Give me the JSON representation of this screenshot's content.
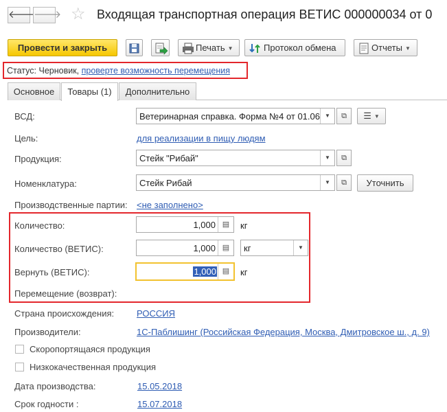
{
  "window": {
    "back_glyph": "🡐",
    "forward_glyph": "🡒",
    "title": "Входящая транспортная операция ВЕТИС 000000034 от 0"
  },
  "toolbar": {
    "post_close_label": "Провести и закрыть",
    "print_label": "Печать",
    "exchange_label": "Протокол обмена",
    "reports_label": "Отчеты"
  },
  "status": {
    "prefix": "Статус:",
    "value": "Черновик,",
    "link": "проверте возможность перемещения"
  },
  "tabs": [
    {
      "label": "Основное"
    },
    {
      "label": "Товары (1)"
    },
    {
      "label": "Дополнительно"
    }
  ],
  "form": {
    "vsd_label": "ВСД:",
    "vsd_value": "Ветеринарная справка. Форма №4 от 01.06",
    "purpose_label": "Цель:",
    "purpose_value": "для реализации в пищу людям",
    "product_label": "Продукция:",
    "product_value": "Стейк \"Рибай\"",
    "nomenclature_label": "Номенклатура:",
    "nomenclature_value": "Стейк Рибай",
    "refine_label": "Уточнить",
    "batches_label": "Производственные партии:",
    "batches_value": "<не заполнено>",
    "qty_label": "Количество:",
    "qty_value": "1,000",
    "qty_unit": "кг",
    "qty_vetis_label": "Количество (ВЕТИС):",
    "qty_vetis_value": "1,000",
    "qty_vetis_unit": "кг",
    "return_label": "Вернуть (ВЕТИС):",
    "return_value": "1,000",
    "return_unit": "кг",
    "move_return_label": "Перемещение (возврат):",
    "country_label": "Страна происхождения:",
    "country_value": "РОССИЯ",
    "producers_label": "Производители:",
    "producers_value": "1С-Паблишинг (Российская Федерация, Москва, Дмитровское ш., д. 9)",
    "perishable_label": "Скоропортящаяся продукция",
    "lowquality_label": "Низкокачественная продукция",
    "prod_date_label": "Дата производства:",
    "prod_date_value": "15.05.2018",
    "expiry_label": "Срок годности :",
    "expiry_value": "15.07.2018"
  }
}
